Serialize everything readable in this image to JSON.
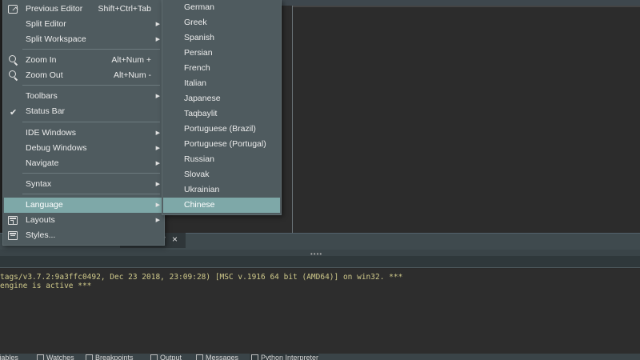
{
  "view_menu": {
    "items": [
      {
        "label": "Previous Editor",
        "shortcut": "Shift+Ctrl+Tab",
        "icon": "previous-editor-icon"
      },
      {
        "label": "Split Editor",
        "submenu": true
      },
      {
        "label": "Split Workspace",
        "submenu": true
      },
      {
        "label": "Zoom In",
        "shortcut": "Alt+Num +",
        "icon": "zoom-in-icon"
      },
      {
        "label": "Zoom Out",
        "shortcut": "Alt+Num -",
        "icon": "zoom-out-icon"
      },
      {
        "label": "Toolbars",
        "submenu": true
      },
      {
        "label": "Status Bar",
        "checked": true,
        "icon": "checkmark-icon"
      },
      {
        "label": "IDE Windows",
        "submenu": true
      },
      {
        "label": "Debug Windows",
        "submenu": true
      },
      {
        "label": "Navigate",
        "submenu": true
      },
      {
        "label": "Syntax",
        "submenu": true
      },
      {
        "label": "Language",
        "submenu": true,
        "highlighted": true
      },
      {
        "label": "Layouts",
        "submenu": true,
        "icon": "layouts-icon"
      },
      {
        "label": "Styles...",
        "icon": "styles-icon"
      }
    ]
  },
  "language_menu": {
    "items": [
      {
        "label": "German"
      },
      {
        "label": "Greek"
      },
      {
        "label": "Spanish"
      },
      {
        "label": "Persian"
      },
      {
        "label": "French"
      },
      {
        "label": "Italian"
      },
      {
        "label": "Japanese"
      },
      {
        "label": "Taqbaylit"
      },
      {
        "label": "Portuguese (Brazil)"
      },
      {
        "label": "Portuguese (Portugal)"
      },
      {
        "label": "Russian"
      },
      {
        "label": "Slovak"
      },
      {
        "label": "Ukrainian"
      },
      {
        "label": "Chinese",
        "highlighted": true
      }
    ]
  },
  "shell": {
    "lines": [
      "tags/v3.7.2:9a3ffc0492, Dec 23 2018, 23:09:28) [MSC v.1916 64 bit (AMD64)] on win32. ***",
      "engine is active ***"
    ]
  },
  "panel": {
    "close_glyph": "×"
  },
  "bottom_tabs": [
    {
      "label": "Variables"
    },
    {
      "label": "Watches"
    },
    {
      "label": "Breakpoints"
    },
    {
      "label": "Output"
    },
    {
      "label": "Messages"
    },
    {
      "label": "Python Interpreter"
    }
  ],
  "colors": {
    "menu_bg": "#4f5b5f",
    "highlight": "#7ea8a8",
    "shell_text": "#cfc98a"
  }
}
